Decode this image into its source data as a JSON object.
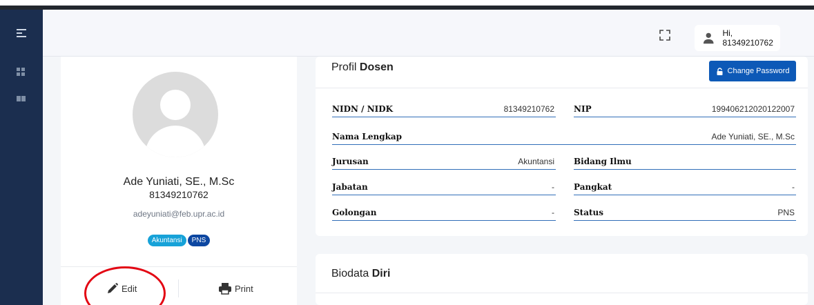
{
  "header": {
    "user_greeting": "Hi, 81349210762"
  },
  "profile": {
    "name": "Ade Yuniati, SE., M.Sc",
    "id": "81349210762",
    "email": "adeyuniati@feb.upr.ac.id",
    "badges": [
      "Akuntansi",
      "PNS"
    ],
    "edit_label": "Edit",
    "print_label": "Print"
  },
  "detail": {
    "title_prefix": "Profil",
    "title_bold": "Dosen",
    "change_password_label": "Change Password",
    "rows": [
      {
        "label": "NIDN / NIDK",
        "value": "81349210762"
      },
      {
        "label": "NIP",
        "value": "199406212020122007"
      },
      {
        "label": "Nama Lengkap",
        "value": "Ade Yuniati, SE., M.Sc"
      },
      {
        "label": "Jurusan",
        "value": "Akuntansi"
      },
      {
        "label": "Bidang Ilmu",
        "value": ""
      },
      {
        "label": "Jabatan",
        "value": "-"
      },
      {
        "label": "Pangkat",
        "value": "-"
      },
      {
        "label": "Golongan",
        "value": "-"
      },
      {
        "label": "Status",
        "value": "PNS"
      }
    ]
  },
  "biodata": {
    "title_prefix": "Biodata",
    "title_bold": "Diri"
  },
  "colors": {
    "sidebar": "#1b2e4f",
    "primary_button": "#0d59b7",
    "badge_jurusan": "#17a2d8",
    "badge_status": "#0d47a1",
    "annotation_circle": "#e30613",
    "row_underline": "#2f6db8"
  },
  "icons": {
    "sidebar_toggle": "menu-icon",
    "sidebar_1": "dashboard-icon",
    "sidebar_2": "book-icon",
    "fullscreen": "fullscreen-icon",
    "user": "user-icon",
    "edit": "pencil-icon",
    "print": "printer-icon",
    "lock": "lock-icon"
  }
}
